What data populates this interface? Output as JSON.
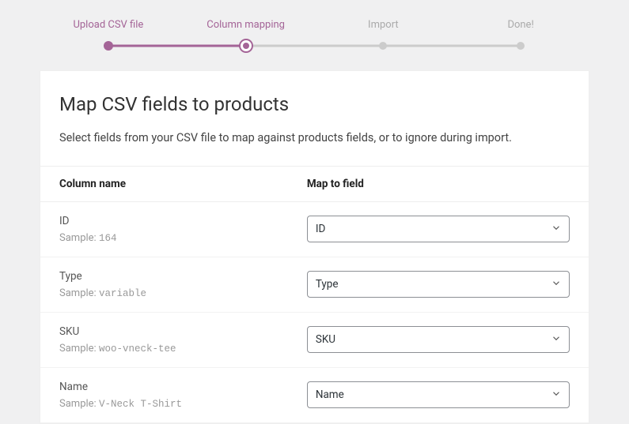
{
  "stepper": {
    "steps": [
      {
        "label": "Upload CSV file",
        "state": "done"
      },
      {
        "label": "Column mapping",
        "state": "active"
      },
      {
        "label": "Import",
        "state": "pending"
      },
      {
        "label": "Done!",
        "state": "pending"
      }
    ]
  },
  "header": {
    "title": "Map CSV fields to products",
    "subtitle": "Select fields from your CSV file to map against products fields, or to ignore during import."
  },
  "table": {
    "column_name_header": "Column name",
    "map_to_field_header": "Map to field",
    "sample_prefix": "Sample:",
    "rows": [
      {
        "name": "ID",
        "sample": "164",
        "selected": "ID"
      },
      {
        "name": "Type",
        "sample": "variable",
        "selected": "Type"
      },
      {
        "name": "SKU",
        "sample": "woo-vneck-tee",
        "selected": "SKU"
      },
      {
        "name": "Name",
        "sample": "V-Neck T-Shirt",
        "selected": "Name"
      }
    ]
  }
}
